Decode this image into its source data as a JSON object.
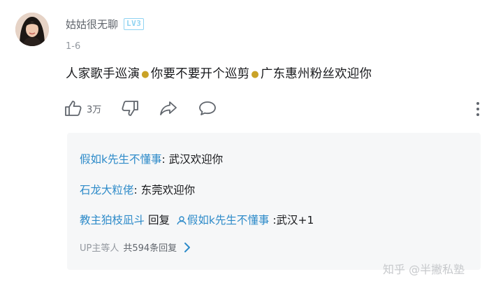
{
  "comment": {
    "username": "姑姑很无聊",
    "level_badge": "LV3",
    "date": "1-6",
    "text_part1": "人家歌手巡演",
    "text_part2": "你要不要开个巡剪",
    "text_part3": "广东惠州粉丝欢迎你",
    "emoji_name": "doge-emoji",
    "like_count": "3万"
  },
  "replies": [
    {
      "user": "假如k先生不懂事",
      "text": ": 武汉欢迎你"
    },
    {
      "user": "石龙大粒佬",
      "text": ": 东莞欢迎你"
    },
    {
      "user": "教主狛枝凪斗",
      "reply_word": "回复",
      "target": "假如k先生不懂事",
      "text": ":武汉+1"
    }
  ],
  "more_replies": {
    "prefix": "UP主等人",
    "count_text": "共594条回复"
  },
  "watermark": "知乎 @半撇私塾",
  "colors": {
    "username_link": "#2e8bc9",
    "level_badge": "#8fd3f2",
    "reply_bg": "#f6f7f8"
  }
}
